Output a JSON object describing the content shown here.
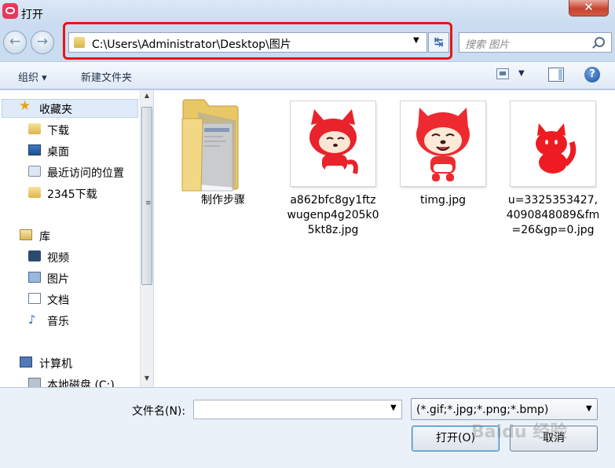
{
  "window": {
    "title": "打开",
    "close_glyph": "✕"
  },
  "nav": {
    "back_glyph": "←",
    "forward_glyph": "→",
    "address_path": "C:\\Users\\Administrator\\Desktop\\图片",
    "dropdown_glyph": "▼",
    "refresh_glyph": "↹",
    "search_placeholder": "搜索 图片"
  },
  "toolbar": {
    "organize": "组织 ▾",
    "new_folder": "新建文件夹",
    "view_drop": "▼",
    "help": "?"
  },
  "sidebar": {
    "favorites_header": "收藏夹",
    "favorites": [
      "下载",
      "桌面",
      "最近访问的位置",
      "2345下载"
    ],
    "libraries_header": "库",
    "libraries": [
      "视频",
      "图片",
      "文档",
      "音乐"
    ],
    "computer_header": "计算机",
    "drives": [
      "本地磁盘 (C:)"
    ],
    "scroll_up": "▲",
    "scroll_down": "▼",
    "scroll_grip": "≡"
  },
  "files": [
    {
      "name": "制作步骤",
      "kind": "folder"
    },
    {
      "name": "a862bfc8gy1ftzwugenp4g205k05kt8z.jpg",
      "kind": "image"
    },
    {
      "name": "timg.jpg",
      "kind": "image"
    },
    {
      "name": "u=3325353427,4090848089&fm=26&gp=0.jpg",
      "kind": "image"
    }
  ],
  "bottom": {
    "filename_label": "文件名(N):",
    "filename_value": "",
    "filename_drop": "▼",
    "filter": "(*.gif;*.jpg;*.png;*.bmp)",
    "filter_drop": "▼",
    "open_button": "打开(O)",
    "cancel_button": "取消"
  },
  "watermark": "Baidu 经验"
}
